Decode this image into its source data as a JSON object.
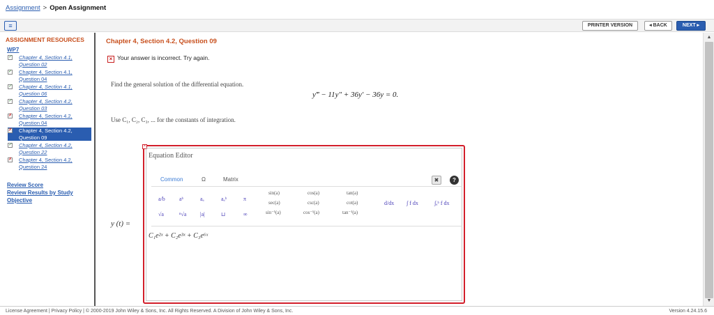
{
  "breadcrumb": {
    "parent": "Assignment",
    "separator": ">",
    "current": "Open Assignment"
  },
  "toolbar": {
    "menu_icon": "≡",
    "printer": "PRINTER VERSION",
    "back": "◂ BACK",
    "next": "NEXT ▸"
  },
  "sidebar": {
    "heading": "ASSIGNMENT RESOURCES",
    "group": "WP7",
    "items": [
      {
        "label": "Chapter 4, Section 4.1, Question 02",
        "status": "✓",
        "italic": true
      },
      {
        "label": "Chapter 4, Section 4.1, Question 04",
        "status": "✓",
        "italic": false
      },
      {
        "label": "Chapter 4, Section 4.1, Question 06",
        "status": "✓",
        "italic": true
      },
      {
        "label": "Chapter 4, Section 4.2, Question 03",
        "status": "✓",
        "italic": true
      },
      {
        "label": "Chapter 4, Section 4.2, Question 04",
        "status": "✗",
        "italic": false
      },
      {
        "label": "Chapter 4, Section 4.2, Question 09",
        "status": "✗",
        "italic": false,
        "active": true
      },
      {
        "label": "Chapter 4, Section 4.2, Question 22",
        "status": "✓",
        "italic": true
      },
      {
        "label": "Chapter 4, Section 4.2, Question 24",
        "status": "✗",
        "italic": false
      }
    ],
    "links": [
      "Review Score",
      "Review Results by Study Objective"
    ]
  },
  "question": {
    "title": "Chapter 4, Section 4.2, Question 09",
    "feedback": "Your answer is incorrect.  Try again.",
    "prompt": "Find the general solution of the differential equation.",
    "equation": "y‴ − 11y″ + 36y′ − 36y = 0.",
    "constants_note": "Use C₁, C₂, C₃, ... for the constants of integration.",
    "answer_label": "y (t) ="
  },
  "editor": {
    "title": "Equation Editor",
    "tabs": [
      "Common",
      "Ω",
      "Matrix"
    ],
    "trash_icon": "✖",
    "help_icon": "?",
    "palette": [
      "a/b",
      "aᵇ",
      "aₐ",
      "aₐᵇ",
      "π",
      "√a",
      "ⁿ√a",
      "|a|",
      "⊔",
      "∞",
      "sin(a)",
      "sec(a)",
      "sin⁻¹(a)",
      "cos(a)",
      "csc(a)",
      "cos⁻¹(a)",
      "tan(a)",
      "cot(a)",
      "tan⁻¹(a)",
      "d/dx",
      "∫ f dx",
      "∫ₐᵇ f dx"
    ],
    "input_value": "C₁e²ˣ + C₂e³ˣ + C₃e⁶ˣ"
  },
  "footer": {
    "text": "License Agreement  |  Privacy Policy  |  © 2000-2019 John Wiley & Sons, Inc. All Rights Reserved. A Division of John Wiley & Sons, Inc.",
    "version": "Version 4.24.15.6"
  },
  "colors": {
    "accent": "#2a5db0",
    "heading": "#c8501e",
    "error": "#d21e2a"
  }
}
